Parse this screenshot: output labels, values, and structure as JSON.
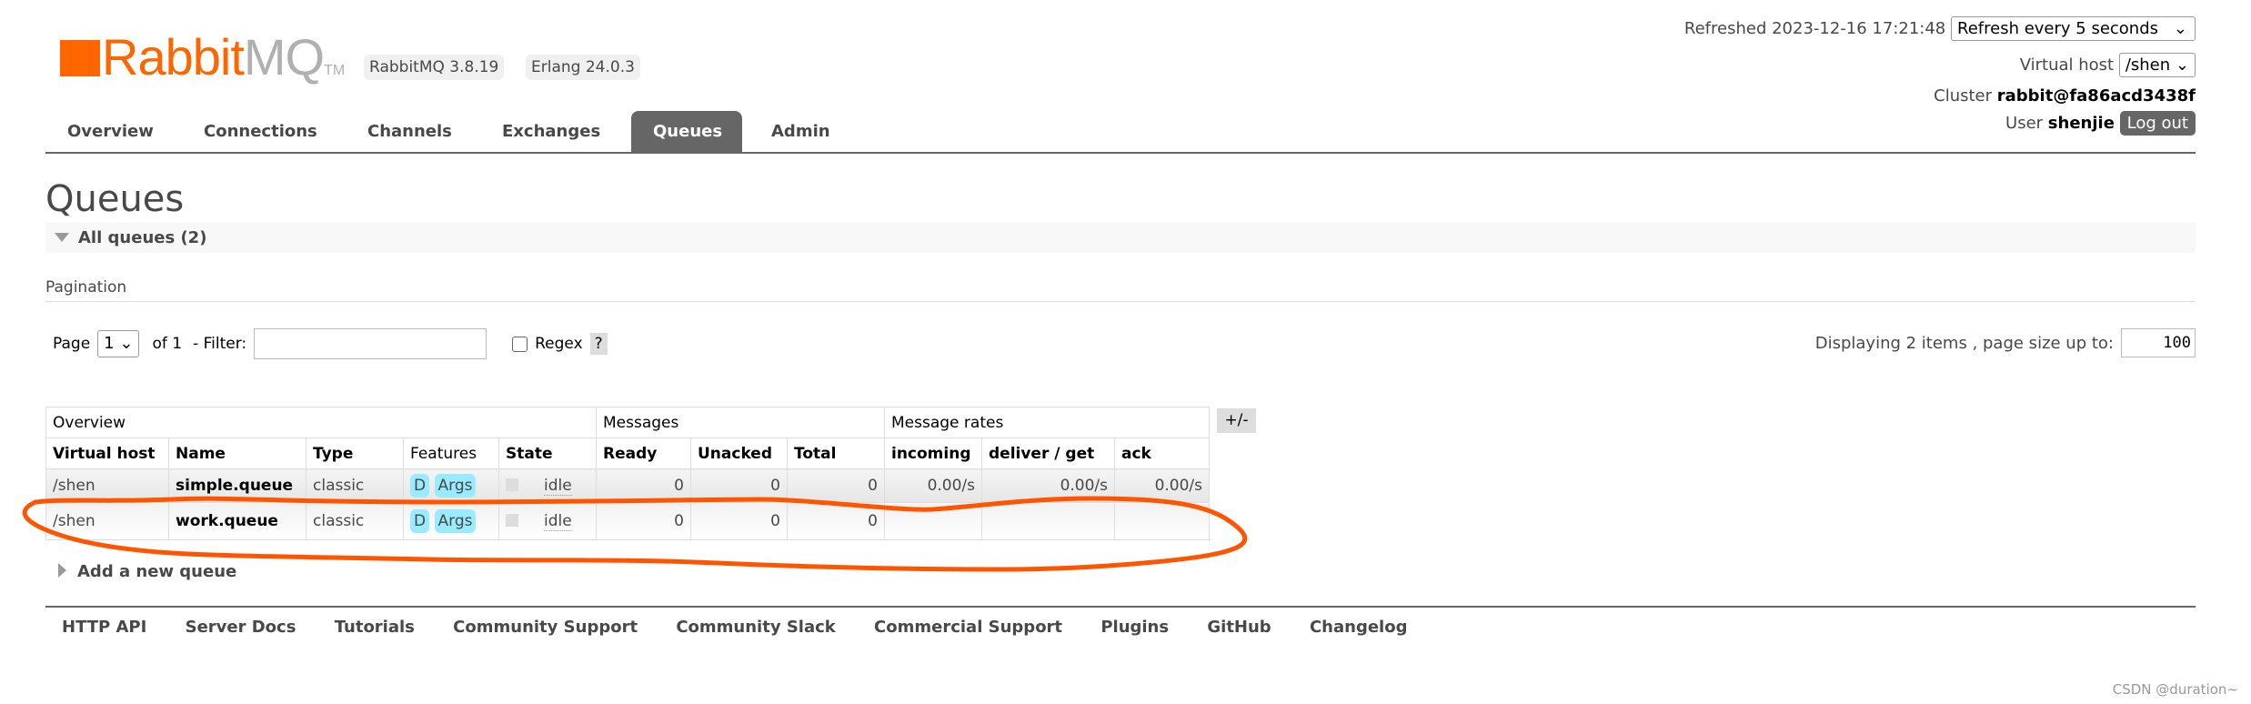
{
  "header": {
    "logo": {
      "rabbit": "Rabbit",
      "mq": "MQ",
      "tm": "TM"
    },
    "rabbitmq_version": "RabbitMQ 3.8.19",
    "erlang_version": "Erlang 24.0.3",
    "refreshed_label": "Refreshed 2023-12-16 17:21:48",
    "refresh_select": "Refresh every 5 seconds",
    "vhost_label": "Virtual host",
    "vhost_select": "/shen",
    "cluster_label": "Cluster",
    "cluster_value": "rabbit@fa86acd3438f",
    "user_label": "User",
    "user_value": "shenjie",
    "logout_label": "Log out"
  },
  "nav": {
    "tabs": [
      {
        "label": "Overview"
      },
      {
        "label": "Connections"
      },
      {
        "label": "Channels"
      },
      {
        "label": "Exchanges"
      },
      {
        "label": "Queues",
        "active": true
      },
      {
        "label": "Admin"
      }
    ]
  },
  "page": {
    "title": "Queues",
    "section_title": "All queues (2)",
    "pagination_label": "Pagination",
    "page_label": "Page",
    "page_select": "1",
    "of_label": "of 1",
    "filter_label": "- Filter:",
    "filter_value": "",
    "regex_label": "Regex",
    "help_label": "?",
    "displaying_label": "Displaying 2 items , page size up to:",
    "page_size": "100",
    "columns_toggle": "+/-",
    "add_queue_label": "Add a new queue"
  },
  "table": {
    "groups": [
      "Overview",
      "Messages",
      "Message rates"
    ],
    "headers": [
      "Virtual host",
      "Name",
      "Type",
      "Features",
      "State",
      "Ready",
      "Unacked",
      "Total",
      "incoming",
      "deliver / get",
      "ack"
    ],
    "rows": [
      {
        "vhost": "/shen",
        "name": "simple.queue",
        "type": "classic",
        "features": [
          "D",
          "Args"
        ],
        "state": "idle",
        "ready": "0",
        "unacked": "0",
        "total": "0",
        "incoming": "0.00/s",
        "deliver_get": "0.00/s",
        "ack": "0.00/s"
      },
      {
        "vhost": "/shen",
        "name": "work.queue",
        "type": "classic",
        "features": [
          "D",
          "Args"
        ],
        "state": "idle",
        "ready": "0",
        "unacked": "0",
        "total": "0",
        "incoming": "",
        "deliver_get": "",
        "ack": ""
      }
    ]
  },
  "footer": {
    "links": [
      "HTTP API",
      "Server Docs",
      "Tutorials",
      "Community Support",
      "Community Slack",
      "Commercial Support",
      "Plugins",
      "GitHub",
      "Changelog"
    ]
  },
  "watermark": "CSDN @duration~",
  "colors": {
    "brand": "#ff6600",
    "annotation": "#ff5500",
    "feature_tag": "#99ebff",
    "active_tab": "#666666"
  }
}
